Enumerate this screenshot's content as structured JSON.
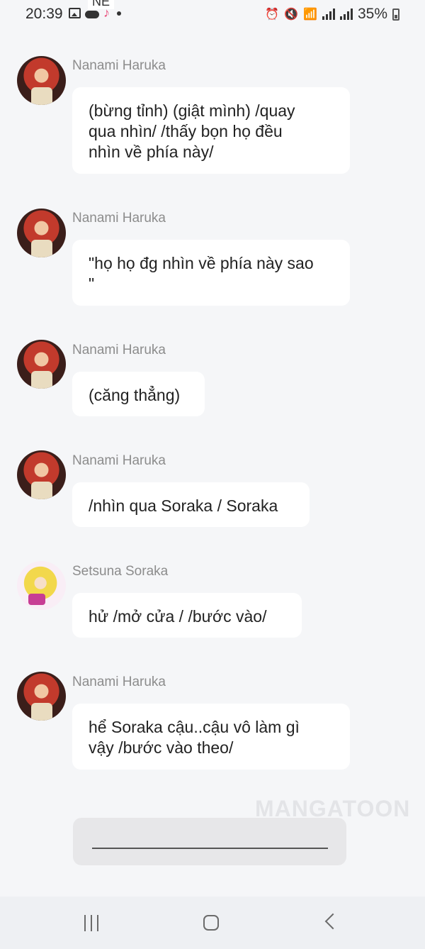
{
  "status_bar": {
    "time": "20:39",
    "notification_overlay": "NE",
    "battery": "35%",
    "icons": [
      "gallery-icon",
      "cloud-icon",
      "tiktok-icon",
      "alarm-icon",
      "mute-icon",
      "wifi-icon",
      "signal-icon",
      "signal-icon",
      "battery-icon"
    ]
  },
  "messages": [
    {
      "sender": "Nanami Haruka",
      "text": "(bừng tỉnh) (giật mình) /quay\nqua nhìn/ /thấy bọn họ đều\nnhìn về phía này/"
    },
    {
      "sender": "Nanami Haruka",
      "text": "\"họ họ đg nhìn về phía này sao\n\""
    },
    {
      "sender": "Nanami Haruka",
      "text": "(căng thẳng)"
    },
    {
      "sender": "Nanami Haruka",
      "text": "/nhìn qua Soraka / Soraka"
    },
    {
      "sender": "Setsuna Soraka",
      "text": "hử /mở cửa / /bước vào/"
    },
    {
      "sender": "Nanami Haruka",
      "text": "hể Soraka cậu..cậu vô làm gì\nvậy /bước vào theo/"
    }
  ],
  "watermark": "MANGATOON",
  "input": {
    "value": ""
  },
  "nav": {
    "icons": [
      "recent-apps-icon",
      "home-icon",
      "back-icon"
    ]
  }
}
